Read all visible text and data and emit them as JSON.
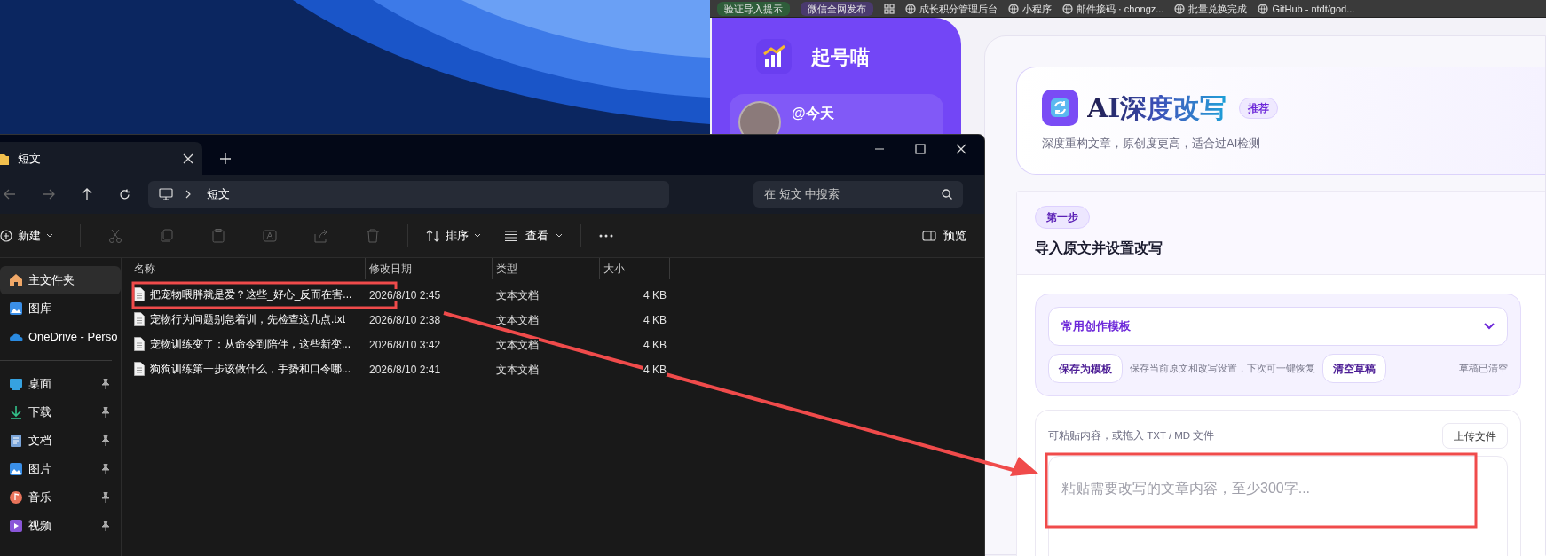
{
  "browser": {
    "bookmarks": [
      {
        "kind": "chip",
        "label": "验证导入提示",
        "color": "#2f5d3a"
      },
      {
        "kind": "chip",
        "label": "微信全网发布",
        "color": "#4a3a6e"
      },
      {
        "kind": "apps"
      },
      {
        "kind": "link",
        "label": "成长积分管理后台"
      },
      {
        "kind": "link",
        "label": "小程序"
      },
      {
        "kind": "link",
        "label": "邮件接码 · chongz..."
      },
      {
        "kind": "link",
        "label": "批量兑换完成"
      },
      {
        "kind": "link",
        "label": "GitHub - ntdt/god..."
      }
    ],
    "sidebar": {
      "brand": "起号喵",
      "user": "@今天"
    },
    "tool_header": {
      "title": "AI深度改写",
      "badge": "推荐",
      "subtitle": "深度重构文章，原创度更高，适合过AI检测"
    },
    "step": {
      "badge": "第一步",
      "title": "导入原文并设置改写",
      "template_select": {
        "value": "常用创作模板"
      },
      "save_button": "保存为模板",
      "save_hint": "保存当前原文和改写设置，下次可一键恢复",
      "clear_button": "清空草稿",
      "draft_status": "草稿已清空",
      "upload_hint": "可粘贴内容，或拖入 TXT / MD 文件",
      "upload_button": "上传文件",
      "textarea": {
        "placeholder": "粘贴需要改写的文章内容，至少300字..."
      }
    }
  },
  "explorer": {
    "tab": "短文",
    "breadcrumb": "短文",
    "search": {
      "placeholder": "在 短文 中搜索"
    },
    "toolbar": {
      "new": "新建",
      "sort": "排序",
      "view": "查看",
      "preview": "预览"
    },
    "nav": [
      {
        "kind": "home",
        "label": "主文件夹",
        "selected": true,
        "pinned": false
      },
      {
        "kind": "gallery",
        "label": "图库",
        "selected": false,
        "pinned": false
      },
      {
        "kind": "cloud",
        "label": "OneDrive - Perso",
        "selected": false,
        "pinned": false
      },
      {
        "kind": "divider"
      },
      {
        "kind": "desktop",
        "label": "桌面",
        "selected": false,
        "pinned": true
      },
      {
        "kind": "download",
        "label": "下载",
        "selected": false,
        "pinned": true
      },
      {
        "kind": "documents",
        "label": "文档",
        "selected": false,
        "pinned": true
      },
      {
        "kind": "pictures",
        "label": "图片",
        "selected": false,
        "pinned": true
      },
      {
        "kind": "music",
        "label": "音乐",
        "selected": false,
        "pinned": true
      },
      {
        "kind": "videos",
        "label": "视频",
        "selected": false,
        "pinned": true
      }
    ],
    "columns": [
      "名称",
      "修改日期",
      "类型",
      "大小"
    ],
    "files": [
      {
        "name": "把宠物喂胖就是爱？这些_好心_反而在害...",
        "date": "2026/8/10 2:45",
        "type": "文本文档",
        "size": "4 KB"
      },
      {
        "name": "宠物行为问题别急着训，先检查这几点.txt",
        "date": "2026/8/10 2:38",
        "type": "文本文档",
        "size": "4 KB"
      },
      {
        "name": "宠物训练变了：从命令到陪伴，这些新变...",
        "date": "2026/8/10 3:42",
        "type": "文本文档",
        "size": "4 KB"
      },
      {
        "name": "狗狗训练第一步该做什么，手势和口令哪...",
        "date": "2026/8/10 2:41",
        "type": "文本文档",
        "size": "4 KB"
      }
    ]
  }
}
